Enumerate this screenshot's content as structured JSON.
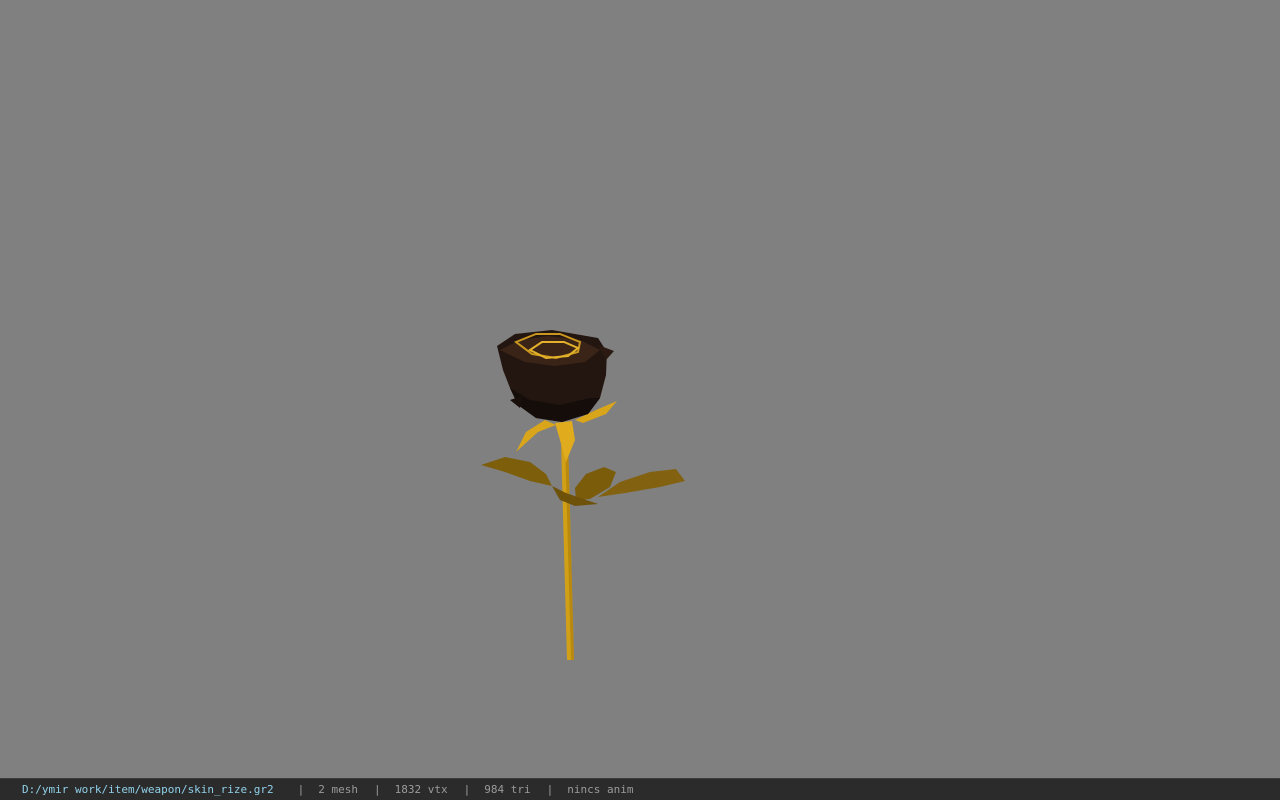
{
  "viewer": {
    "background_color": "#808080",
    "model": {
      "icon": "rose-model",
      "petal_color": "#2a1a14",
      "petal_edge_color": "#c9961e",
      "stem_color": "#d4a017",
      "leaf_color": "#7a5c0a"
    }
  },
  "status_bar": {
    "file_path": "D:/ymir work/item/weapon/skin_rize.gr2",
    "separator": "|",
    "mesh_count": "2 mesh",
    "vertex_count": "1832 vtx",
    "triangle_count": "984 tri",
    "animation": "nincs anim"
  }
}
